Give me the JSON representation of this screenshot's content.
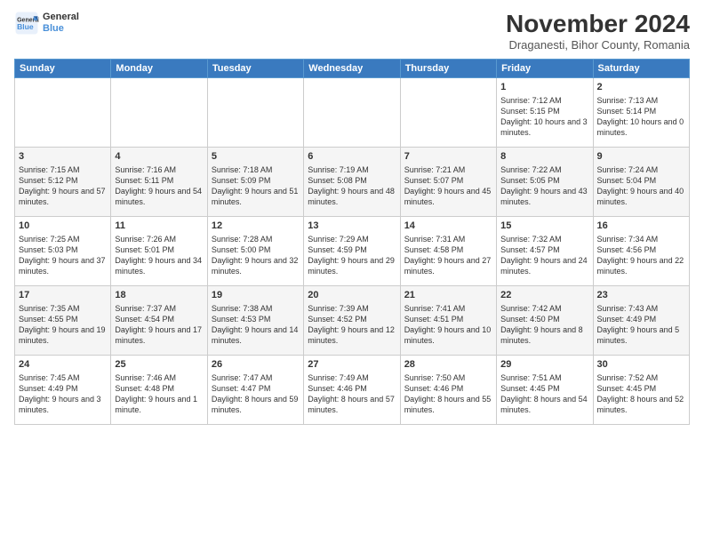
{
  "header": {
    "logo_line1": "General",
    "logo_line2": "Blue",
    "month_title": "November 2024",
    "subtitle": "Draganesti, Bihor County, Romania"
  },
  "days_of_week": [
    "Sunday",
    "Monday",
    "Tuesday",
    "Wednesday",
    "Thursday",
    "Friday",
    "Saturday"
  ],
  "weeks": [
    [
      {
        "day": "",
        "info": ""
      },
      {
        "day": "",
        "info": ""
      },
      {
        "day": "",
        "info": ""
      },
      {
        "day": "",
        "info": ""
      },
      {
        "day": "",
        "info": ""
      },
      {
        "day": "1",
        "info": "Sunrise: 7:12 AM\nSunset: 5:15 PM\nDaylight: 10 hours and 3 minutes."
      },
      {
        "day": "2",
        "info": "Sunrise: 7:13 AM\nSunset: 5:14 PM\nDaylight: 10 hours and 0 minutes."
      }
    ],
    [
      {
        "day": "3",
        "info": "Sunrise: 7:15 AM\nSunset: 5:12 PM\nDaylight: 9 hours and 57 minutes."
      },
      {
        "day": "4",
        "info": "Sunrise: 7:16 AM\nSunset: 5:11 PM\nDaylight: 9 hours and 54 minutes."
      },
      {
        "day": "5",
        "info": "Sunrise: 7:18 AM\nSunset: 5:09 PM\nDaylight: 9 hours and 51 minutes."
      },
      {
        "day": "6",
        "info": "Sunrise: 7:19 AM\nSunset: 5:08 PM\nDaylight: 9 hours and 48 minutes."
      },
      {
        "day": "7",
        "info": "Sunrise: 7:21 AM\nSunset: 5:07 PM\nDaylight: 9 hours and 45 minutes."
      },
      {
        "day": "8",
        "info": "Sunrise: 7:22 AM\nSunset: 5:05 PM\nDaylight: 9 hours and 43 minutes."
      },
      {
        "day": "9",
        "info": "Sunrise: 7:24 AM\nSunset: 5:04 PM\nDaylight: 9 hours and 40 minutes."
      }
    ],
    [
      {
        "day": "10",
        "info": "Sunrise: 7:25 AM\nSunset: 5:03 PM\nDaylight: 9 hours and 37 minutes."
      },
      {
        "day": "11",
        "info": "Sunrise: 7:26 AM\nSunset: 5:01 PM\nDaylight: 9 hours and 34 minutes."
      },
      {
        "day": "12",
        "info": "Sunrise: 7:28 AM\nSunset: 5:00 PM\nDaylight: 9 hours and 32 minutes."
      },
      {
        "day": "13",
        "info": "Sunrise: 7:29 AM\nSunset: 4:59 PM\nDaylight: 9 hours and 29 minutes."
      },
      {
        "day": "14",
        "info": "Sunrise: 7:31 AM\nSunset: 4:58 PM\nDaylight: 9 hours and 27 minutes."
      },
      {
        "day": "15",
        "info": "Sunrise: 7:32 AM\nSunset: 4:57 PM\nDaylight: 9 hours and 24 minutes."
      },
      {
        "day": "16",
        "info": "Sunrise: 7:34 AM\nSunset: 4:56 PM\nDaylight: 9 hours and 22 minutes."
      }
    ],
    [
      {
        "day": "17",
        "info": "Sunrise: 7:35 AM\nSunset: 4:55 PM\nDaylight: 9 hours and 19 minutes."
      },
      {
        "day": "18",
        "info": "Sunrise: 7:37 AM\nSunset: 4:54 PM\nDaylight: 9 hours and 17 minutes."
      },
      {
        "day": "19",
        "info": "Sunrise: 7:38 AM\nSunset: 4:53 PM\nDaylight: 9 hours and 14 minutes."
      },
      {
        "day": "20",
        "info": "Sunrise: 7:39 AM\nSunset: 4:52 PM\nDaylight: 9 hours and 12 minutes."
      },
      {
        "day": "21",
        "info": "Sunrise: 7:41 AM\nSunset: 4:51 PM\nDaylight: 9 hours and 10 minutes."
      },
      {
        "day": "22",
        "info": "Sunrise: 7:42 AM\nSunset: 4:50 PM\nDaylight: 9 hours and 8 minutes."
      },
      {
        "day": "23",
        "info": "Sunrise: 7:43 AM\nSunset: 4:49 PM\nDaylight: 9 hours and 5 minutes."
      }
    ],
    [
      {
        "day": "24",
        "info": "Sunrise: 7:45 AM\nSunset: 4:49 PM\nDaylight: 9 hours and 3 minutes."
      },
      {
        "day": "25",
        "info": "Sunrise: 7:46 AM\nSunset: 4:48 PM\nDaylight: 9 hours and 1 minute."
      },
      {
        "day": "26",
        "info": "Sunrise: 7:47 AM\nSunset: 4:47 PM\nDaylight: 8 hours and 59 minutes."
      },
      {
        "day": "27",
        "info": "Sunrise: 7:49 AM\nSunset: 4:46 PM\nDaylight: 8 hours and 57 minutes."
      },
      {
        "day": "28",
        "info": "Sunrise: 7:50 AM\nSunset: 4:46 PM\nDaylight: 8 hours and 55 minutes."
      },
      {
        "day": "29",
        "info": "Sunrise: 7:51 AM\nSunset: 4:45 PM\nDaylight: 8 hours and 54 minutes."
      },
      {
        "day": "30",
        "info": "Sunrise: 7:52 AM\nSunset: 4:45 PM\nDaylight: 8 hours and 52 minutes."
      }
    ]
  ]
}
